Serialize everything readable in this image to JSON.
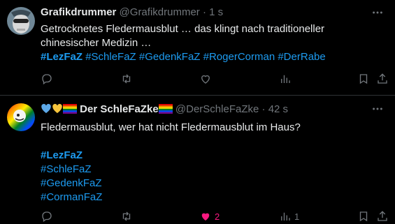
{
  "tweets": [
    {
      "name": "Grafikdrummer",
      "handle": "@Grafikdrummer",
      "dot": "·",
      "time": "1 s",
      "line1": "Getrocknetes Fledermausblut … das klingt nach traditioneller",
      "line2": "chinesischer Medizin …",
      "tags": [
        "#LezFaZ",
        "#SchleFaZ",
        "#GedenkFaZ",
        "#RogerCorman",
        "#DerRabe"
      ],
      "likes": "",
      "views": ""
    },
    {
      "name": "Der SchleFaZke",
      "handle": "@DerSchleFaZke",
      "dot": "·",
      "time": "42 s",
      "line1": "Fledermausblut, wer hat nicht Fledermausblut im Haus?",
      "tags": [
        "#LezFaZ",
        "#SchleFaZ",
        "#GedenkFaZ",
        "#CormanFaZ"
      ],
      "likes": "2",
      "views": "1"
    }
  ],
  "colors": {
    "accent": "#1d9bf0",
    "like": "#f91880",
    "muted": "#71767b",
    "text": "#e7e9ea",
    "bg": "#000000"
  },
  "icons": [
    "reply-icon",
    "retweet-icon",
    "like-icon",
    "views-icon",
    "bookmark-icon",
    "share-icon",
    "more-icon"
  ]
}
